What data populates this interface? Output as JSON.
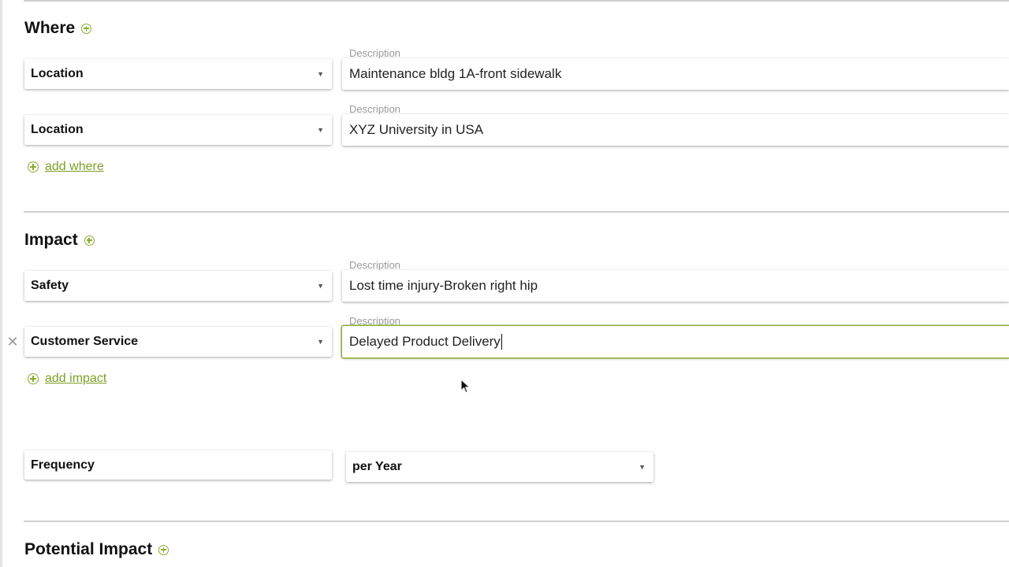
{
  "where": {
    "title": "Where",
    "rows": [
      {
        "type": "Location",
        "description_label": "Description",
        "description": "Maintenance bldg 1A-front sidewalk"
      },
      {
        "type": "Location",
        "description_label": "Description",
        "description": "XYZ University in USA"
      }
    ],
    "add_label": "add where"
  },
  "impact": {
    "title": "Impact",
    "rows": [
      {
        "type": "Safety",
        "description_label": "Description",
        "description": "Lost time injury-Broken right hip"
      },
      {
        "type": "Customer Service",
        "description_label": "Description",
        "description": "Delayed Product Delivery"
      }
    ],
    "add_label": "add impact"
  },
  "frequency": {
    "label": "Frequency",
    "period": "per Year"
  },
  "potential_impact": {
    "title": "Potential Impact"
  },
  "icons": {
    "add": "plus-circle-icon",
    "remove": "close-icon",
    "dropdown": "caret-down-icon"
  },
  "colors": {
    "accent": "#8aab2f",
    "link": "#7d9f25",
    "divider": "#cfcfcf"
  }
}
